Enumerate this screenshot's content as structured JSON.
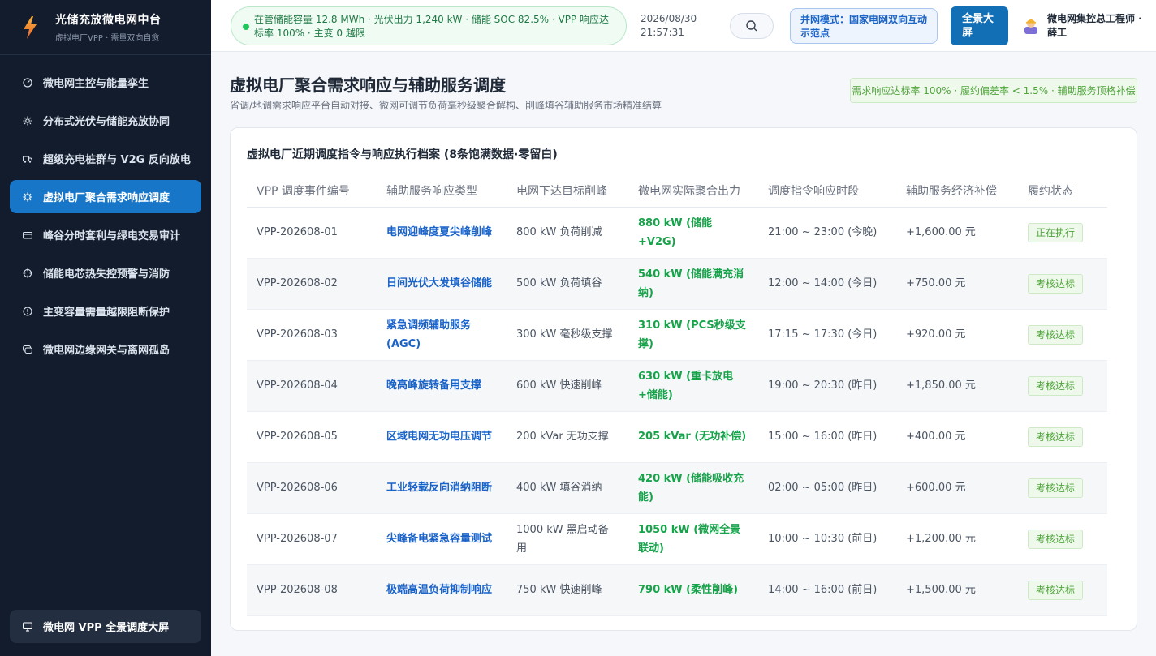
{
  "brand": {
    "title": "光储充放微电网中台",
    "subtitle": "虚拟电厂VPP · 需量双向自愈"
  },
  "sidebar": {
    "items": [
      {
        "label": "微电网主控与能量孪生",
        "icon": "dashboard-icon"
      },
      {
        "label": "分布式光伏与储能充放协同",
        "icon": "sun-icon"
      },
      {
        "label": "超级充电桩群与 V2G 反向放电",
        "icon": "truck-icon"
      },
      {
        "label": "虚拟电厂聚合需求响应调度",
        "icon": "gear-icon",
        "active": true
      },
      {
        "label": "峰谷分时套利与绿电交易审计",
        "icon": "wallet-icon"
      },
      {
        "label": "储能电芯热失控预警与消防",
        "icon": "crosshair-icon"
      },
      {
        "label": "主变容量需量越限阻断保护",
        "icon": "alert-icon"
      },
      {
        "label": "微电网边缘网关与离网孤岛",
        "icon": "chat-icon"
      }
    ],
    "bottom": {
      "label": "微电网 VPP 全景调度大屏",
      "icon": "monitor-icon"
    }
  },
  "header": {
    "status": "在管储能容量 12.8 MWh · 光伏出力 1,240 kW · 储能 SOC 82.5% · VPP 响应达标率 100% · 主变 0 越限",
    "date": "2026/08/30",
    "time": "21:57:31",
    "grid_mode": "并网模式：国家电网双向互动示范点",
    "big_screen": "全景大屏",
    "user": "微电网集控总工程师 · 薛工"
  },
  "page": {
    "title": "虚拟电厂聚合需求响应与辅助服务调度",
    "subtitle": "省调/地调需求响应平台自动对接、微网可调节负荷毫秒级聚合解构、削峰填谷辅助服务市场精准结算",
    "kpi": "需求响应达标率 100% · 履约偏差率 < 1.5% · 辅助服务顶格补偿"
  },
  "card": {
    "title": "虚拟电厂近期调度指令与响应执行档案 (8条饱满数据·零留白)",
    "columns": [
      "VPP 调度事件编号",
      "辅助服务响应类型",
      "电网下达目标削峰",
      "微电网实际聚合出力",
      "调度指令响应时段",
      "辅助服务经济补偿",
      "履约状态"
    ],
    "rows": [
      {
        "id": "VPP-202608-01",
        "type": "电网迎峰度夏尖峰削峰",
        "target": "800 kW 负荷削减",
        "actual": "880 kW (储能+V2G)",
        "period": "21:00 ~ 23:00 (今晚)",
        "comp": "+1,600.00 元",
        "status": "正在执行"
      },
      {
        "id": "VPP-202608-02",
        "type": "日间光伏大发填谷储能",
        "target": "500 kW 负荷填谷",
        "actual": "540 kW (储能满充消纳)",
        "period": "12:00 ~ 14:00 (今日)",
        "comp": "+750.00 元",
        "status": "考核达标"
      },
      {
        "id": "VPP-202608-03",
        "type": "紧急调频辅助服务 (AGC)",
        "target": "300 kW 毫秒级支撑",
        "actual": "310 kW (PCS秒级支撑)",
        "period": "17:15 ~ 17:30 (今日)",
        "comp": "+920.00 元",
        "status": "考核达标"
      },
      {
        "id": "VPP-202608-04",
        "type": "晚高峰旋转备用支撑",
        "target": "600 kW 快速削峰",
        "actual": "630 kW (重卡放电+储能)",
        "period": "19:00 ~ 20:30 (昨日)",
        "comp": "+1,850.00 元",
        "status": "考核达标"
      },
      {
        "id": "VPP-202608-05",
        "type": "区域电网无功电压调节",
        "target": "200 kVar 无功支撑",
        "actual": "205 kVar (无功补偿)",
        "period": "15:00 ~ 16:00 (昨日)",
        "comp": "+400.00 元",
        "status": "考核达标"
      },
      {
        "id": "VPP-202608-06",
        "type": "工业轻载反向消纳阻断",
        "target": "400 kW 填谷消纳",
        "actual": "420 kW (储能吸收充能)",
        "period": "02:00 ~ 05:00 (昨日)",
        "comp": "+600.00 元",
        "status": "考核达标"
      },
      {
        "id": "VPP-202608-07",
        "type": "尖峰备电紧急容量测试",
        "target": "1000 kW 黑启动备用",
        "actual": "1050 kW (微网全景联动)",
        "period": "10:00 ~ 10:30 (前日)",
        "comp": "+1,200.00 元",
        "status": "考核达标"
      },
      {
        "id": "VPP-202608-08",
        "type": "极端高温负荷抑制响应",
        "target": "750 kW 快速削峰",
        "actual": "790 kW (柔性削峰)",
        "period": "14:00 ~ 16:00 (前日)",
        "comp": "+1,500.00 元",
        "status": "考核达标"
      }
    ]
  }
}
